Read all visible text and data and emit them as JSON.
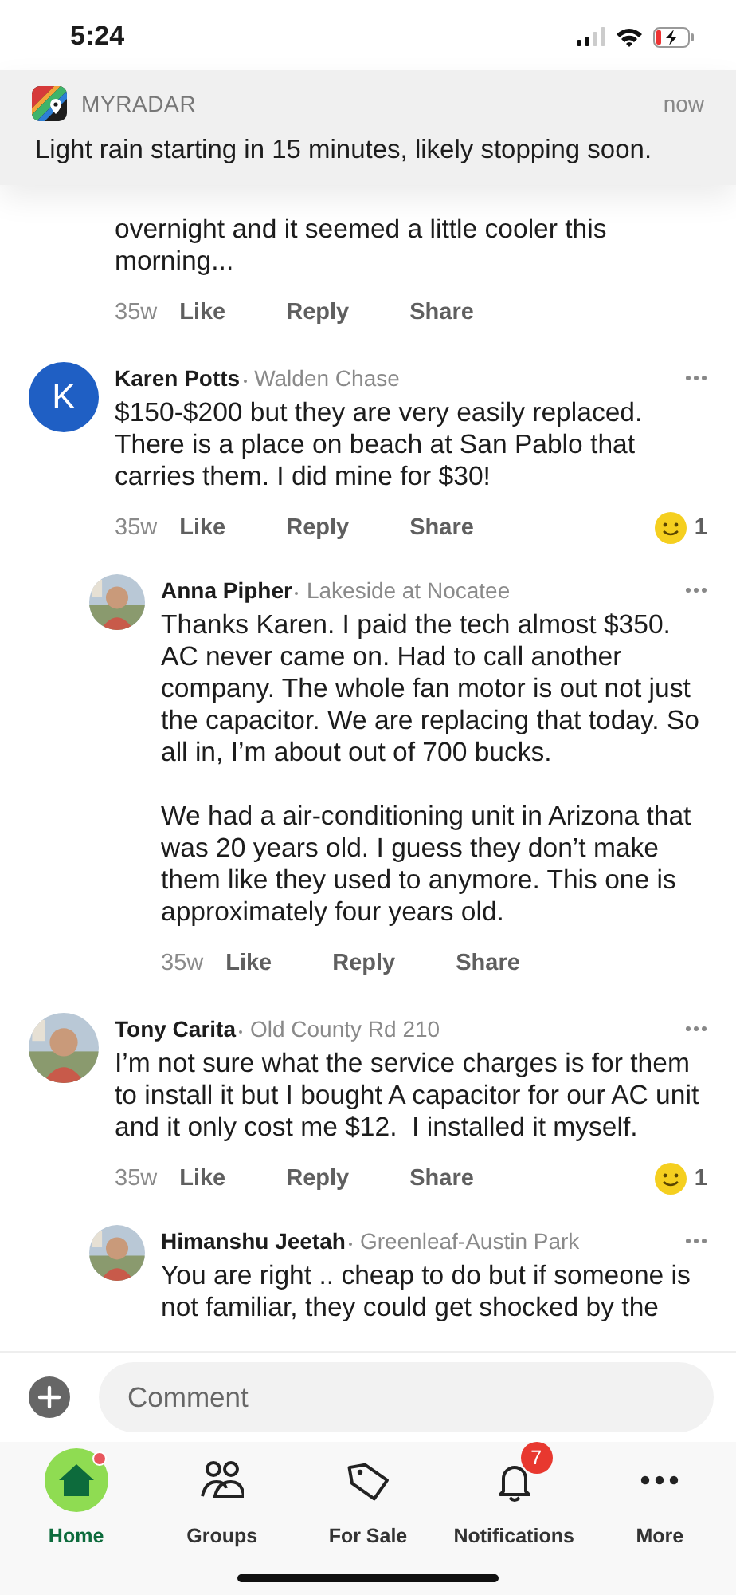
{
  "status_bar": {
    "time": "5:24"
  },
  "notification": {
    "app": "MYRADAR",
    "time": "now",
    "message": "Light rain starting in 15 minutes, likely stopping soon."
  },
  "comments": [
    {
      "kind": "fragment",
      "text": "overnight and it seemed a little cooler this morning...",
      "time": "35w",
      "actions": [
        "Like",
        "Reply",
        "Share"
      ]
    },
    {
      "kind": "comment",
      "avatar": {
        "kind": "letter",
        "letter": "K"
      },
      "author": "Karen Potts",
      "neighborhood": "Walden Chase",
      "text": "$150-$200 but they are very easily replaced. There is a place on beach at San Pablo that carries them. I did mine for $30!",
      "time": "35w",
      "actions": [
        "Like",
        "Reply",
        "Share"
      ],
      "reactions": "1",
      "children": [
        {
          "kind": "comment",
          "author": "Anna Pipher",
          "neighborhood": "Lakeside at Nocatee",
          "text": "Thanks Karen. I paid the tech almost $350. AC never came on. Had to call another company. The whole fan motor is out not just the capacitor. We are replacing that today. So all in, I’m about out of 700 bucks.\n\nWe had a air-conditioning unit in Arizona that was 20 years old. I guess they don’t make them like they used to anymore. This one is approximately four years old.",
          "time": "35w",
          "actions": [
            "Like",
            "Reply",
            "Share"
          ]
        }
      ]
    },
    {
      "kind": "comment",
      "author": "Tony Carita",
      "neighborhood": "Old County Rd 210",
      "text": "I’m not sure what the service charges is for them to install it but I bought A capacitor for our AC unit and it only cost me $12.  I installed it myself.",
      "time": "35w",
      "actions": [
        "Like",
        "Reply",
        "Share"
      ],
      "reactions": "1",
      "children": [
        {
          "kind": "comment",
          "author": "Himanshu Jeetah",
          "neighborhood": "Greenleaf-Austin Park",
          "text": "You are right .. cheap to do but if someone is not familiar, they could get shocked by the"
        }
      ]
    }
  ],
  "composer": {
    "placeholder": "Comment"
  },
  "tabs": [
    {
      "kind": "home",
      "label": "Home",
      "selected": true,
      "dot": true
    },
    {
      "kind": "groups",
      "label": "Groups",
      "selected": false,
      "dot": false
    },
    {
      "kind": "tag",
      "label": "For Sale",
      "selected": false,
      "dot": false
    },
    {
      "kind": "bell",
      "label": "Notifications",
      "selected": false,
      "dot": false,
      "badge": "7"
    },
    {
      "kind": "more",
      "label": "More",
      "selected": false,
      "dot": false
    }
  ]
}
